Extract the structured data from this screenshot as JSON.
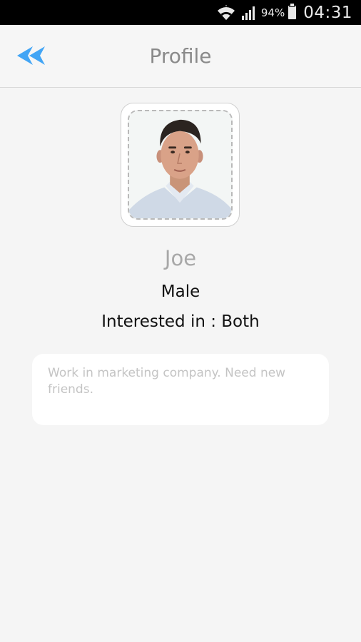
{
  "status_bar": {
    "battery_percent": "94%",
    "battery_level": 0.94,
    "time": "04:31",
    "icons": [
      "wifi-icon",
      "signal-icon",
      "battery-icon"
    ]
  },
  "header": {
    "title": "Profile",
    "back_icon": "double-chevron-left-icon",
    "accent_color": "#42a5f5"
  },
  "profile": {
    "avatar_icon": "profile-photo",
    "name": "Joe",
    "gender": "Male",
    "interested_label": "Interested in : ",
    "interested_value": "Both",
    "about": "Work in marketing company. Need new friends."
  }
}
